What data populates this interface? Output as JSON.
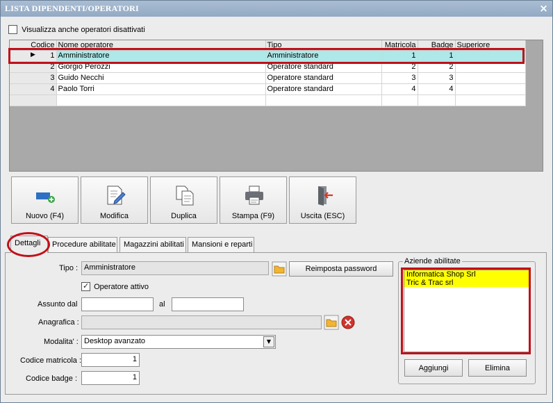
{
  "window": {
    "title": "LISTA DIPENDENTI/OPERATORI",
    "close_glyph": "×"
  },
  "show_disabled": {
    "label": "Visualizza anche operatori disattivati",
    "checked": false
  },
  "grid": {
    "columns": [
      "Codice",
      "Nome operatore",
      "Tipo",
      "Matricola",
      "Badge",
      "Superiore"
    ],
    "rows": [
      {
        "codice": "1",
        "nome": "Amministratore",
        "tipo": "Amministratore",
        "matricola": "1",
        "badge": "1",
        "superiore": ""
      },
      {
        "codice": "2",
        "nome": "Giorgio Perozzi",
        "tipo": "Operatore standard",
        "matricola": "2",
        "badge": "2",
        "superiore": ""
      },
      {
        "codice": "3",
        "nome": "Guido Necchi",
        "tipo": "Operatore standard",
        "matricola": "3",
        "badge": "3",
        "superiore": ""
      },
      {
        "codice": "4",
        "nome": "Paolo Torri",
        "tipo": "Operatore standard",
        "matricola": "4",
        "badge": "4",
        "superiore": ""
      }
    ],
    "selected_row_index": 0,
    "row_pointer_glyph": "▶"
  },
  "toolbar": {
    "nuovo": "Nuovo (F4)",
    "modifica": "Modifica",
    "duplica": "Duplica",
    "stampa": "Stampa (F9)",
    "uscita": "Uscita (ESC)"
  },
  "tabs": [
    "Dettagli",
    "Procedure abilitate",
    "Magazzini abilitati",
    "Mansioni e reparti"
  ],
  "active_tab": "Dettagli",
  "details": {
    "tipo_label": "Tipo :",
    "tipo_value": "Amministratore",
    "reset_password": "Reimposta password",
    "attivo_label": "Operatore attivo",
    "attivo_checked": true,
    "assunto_label": "Assunto dal",
    "assunto_value": "",
    "al_label": "al",
    "al_value": "",
    "anagrafica_label": "Anagrafica :",
    "anagrafica_value": "",
    "modalita_label": "Modalita' :",
    "modalita_value": "Desktop avanzato",
    "matricola_label": "Codice matricola :",
    "matricola_value": "1",
    "badge_label": "Codice badge :",
    "badge_value": "1"
  },
  "aziende": {
    "title": "Aziende abilitate",
    "items": [
      "Informatica Shop Srl",
      "Tric & Trac srl"
    ],
    "aggiungi": "Aggiungi",
    "elimina": "Elimina"
  },
  "colors": {
    "highlight_red": "#c0101a",
    "selected_row": "#aee8e8",
    "list_item": "#ffff00",
    "title_bar": "#93aac4"
  }
}
